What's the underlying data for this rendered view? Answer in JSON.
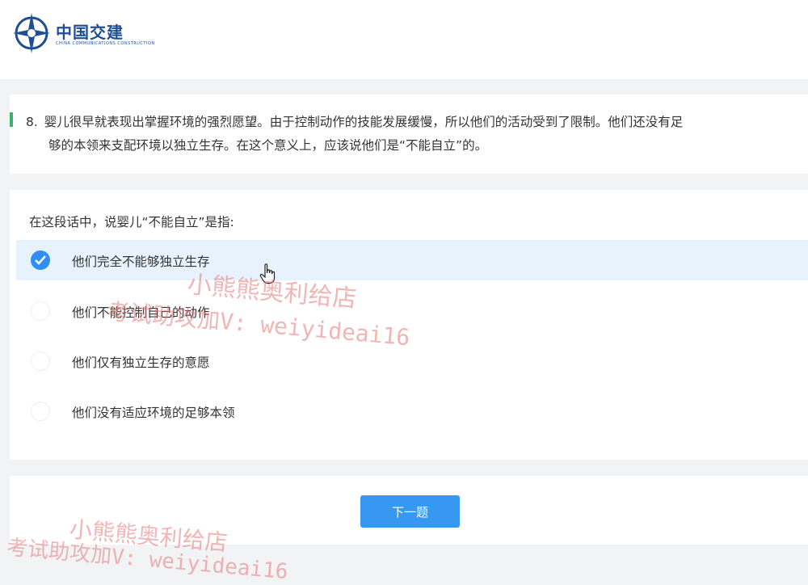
{
  "header": {
    "logo_text": "中国交建",
    "logo_subtext": "CHINA COMMUNICATIONS CONSTRUCTION"
  },
  "question": {
    "number": "8.",
    "text_line1": "婴儿很早就表现出掌握环境的强烈愿望。由于控制动作的技能发展缓慢，所以他们的活动受到了限制。他们还没有足",
    "text_line2": "够的本领来支配环境以独立生存。在这个意义上，应该说他们是“不能自立”的。",
    "prompt": "在这段话中，说婴儿“不能自立”是指:"
  },
  "options": [
    {
      "label": "他们完全不能够独立生存",
      "selected": true
    },
    {
      "label": "他们不能控制自己的动作",
      "selected": false
    },
    {
      "label": "他们仅有独立生存的意愿",
      "selected": false
    },
    {
      "label": "他们没有适应环境的足够本领",
      "selected": false
    }
  ],
  "footer": {
    "next_label": "下一题"
  },
  "watermark": {
    "line1": "小熊熊奥利给店",
    "line2": "考试助攻加V: weiyideai16"
  },
  "colors": {
    "accent": "#3798f2",
    "question_bar": "#3bb36a",
    "selected_bg": "#e8f2fd",
    "logo": "#1e4f96"
  }
}
